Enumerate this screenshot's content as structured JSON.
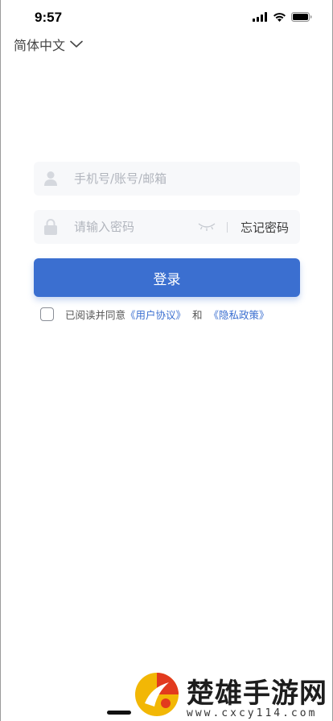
{
  "status_bar": {
    "time": "9:57",
    "icons": [
      "cellular-signal-icon",
      "wifi-icon",
      "battery-icon"
    ]
  },
  "language": {
    "label": "简体中文",
    "icon": "chevron-down-icon"
  },
  "account_field": {
    "placeholder": "手机号/账号/邮箱",
    "icon": "user-icon"
  },
  "password_field": {
    "placeholder": "请输入密码",
    "icon": "lock-icon",
    "toggle_icon": "eye-closed-icon",
    "forgot_label": "忘记密码"
  },
  "login_button": {
    "label": "登录"
  },
  "agreement": {
    "checked": false,
    "prefix": "已阅读并同意",
    "user_agreement": "《用户协议》",
    "conjunction": "和",
    "privacy_policy": "《隐私政策》"
  },
  "watermark": {
    "title": "楚雄手游网",
    "url": "www.cxcy114.com"
  },
  "colors": {
    "accent": "#3b6fd0",
    "field_bg": "#f7f8fa",
    "placeholder": "#b1b5bd"
  }
}
